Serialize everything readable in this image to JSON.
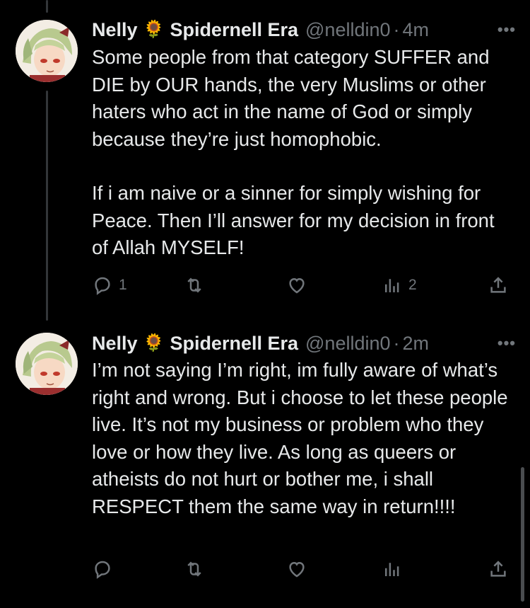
{
  "tweets": [
    {
      "name": "Nelly",
      "flower": "🌻",
      "display_suffix": "Spidernell Era",
      "handle": "@nelldin0",
      "dot": "·",
      "time": "4m",
      "more": "•••",
      "paragraphs": [
        "Some people from that category SUFFER and DIE by OUR hands, the very Muslims or other haters who act in the name of God or simply because they’re just homophobic.",
        "If i am naive or a sinner for simply wishing for Peace. Then I’ll answer for my decision in front of Allah MYSELF!"
      ],
      "replies": "1",
      "retweets": "",
      "likes": "",
      "views": "2"
    },
    {
      "name": "Nelly",
      "flower": "🌻",
      "display_suffix": "Spidernell Era",
      "handle": "@nelldin0",
      "dot": "·",
      "time": "2m",
      "more": "•••",
      "paragraphs": [
        "I’m not saying I’m right, im fully aware of what’s right and wrong. But i choose to let these people live. It’s not my business or problem who they love or how they live. As long as queers or atheists do not hurt or bother me, i shall RESPECT them the same way in return!!!!"
      ],
      "replies": "",
      "retweets": "",
      "likes": "",
      "views": ""
    }
  ],
  "icons": {
    "reply": "reply-icon",
    "retweet": "retweet-icon",
    "like": "heart-icon",
    "views": "views-icon",
    "share": "share-icon"
  },
  "colors": {
    "background": "#000000",
    "text": "#e7e9ea",
    "muted": "#71767b",
    "thread_line": "#333639"
  }
}
